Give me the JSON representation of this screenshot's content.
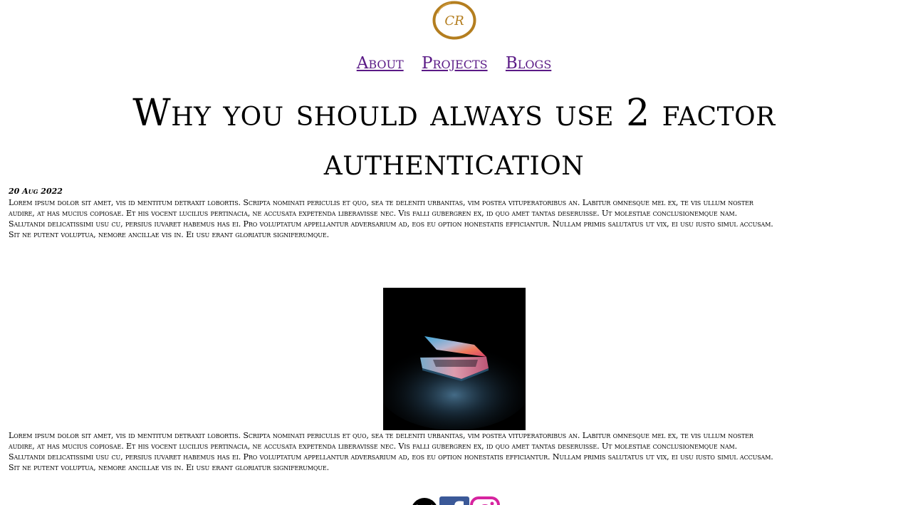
{
  "logo": {
    "text": "CR",
    "ring_color": "#b47e1f"
  },
  "nav": {
    "items": [
      {
        "label": "About"
      },
      {
        "label": "Projects"
      },
      {
        "label": "Blogs"
      }
    ],
    "link_color": "#5a1a86"
  },
  "post": {
    "title": "Why you should always use 2 factor authentication",
    "date": "20 Aug 2022",
    "paragraph_1": "Lorem ipsum dolor sit amet, vis id mentitum detraxit lobortis. Scripta nominati periculis et quo, sea te deleniti urbanitas, vim postea vituperatoribus an. Labitur omnesque mel ex, te vis ullum noster\naudire, at has mucius copiosae. Et his vocent lucilius pertinacia, ne accusata expetenda liberavisse nec. Vis falli gubergren ex, id quo amet tantas deseruisse. Ut molestiae conclusionemque nam.\nSalutandi delicatissimi usu cu, persius iuvaret habemus has ei. Pro voluptatum appellantur adversarium ad, eos eu option honestatis efficiantur. Nullam primis salutatus ut vix, ei usu iusto simul accusam.\nSit ne putent voluptua, nemore ancillae vis in. Ei usu erant gloriatur signiferumque.",
    "image_icon": "laptop-photo",
    "paragraph_2": "Lorem ipsum dolor sit amet, vis id mentitum detraxit lobortis. Scripta nominati periculis et quo, sea te deleniti urbanitas, vim postea vituperatoribus an. Labitur omnesque mel ex, te vis ullum noster\naudire, at has mucius copiosae. Et his vocent lucilius pertinacia, ne accusata expetenda liberavisse nec. Vis falli gubergren ex, id quo amet tantas deseruisse. Ut molestiae conclusionemque nam.\nSalutandi delicatissimi usu cu, persius iuvaret habemus has ei. Pro voluptatum appellantur adversarium ad, eos eu option honestatis efficiantur. Nullam primis salutatus ut vix, ei usu iusto simul accusam.\nSit ne putent voluptua, nemore ancillae vis in. Ei usu erant gloriatur signiferumque."
  },
  "social": {
    "icons": [
      "email-icon",
      "facebook-icon",
      "instagram-icon"
    ],
    "facebook_color": "#3b5998",
    "instagram_color": "#d6249f"
  }
}
